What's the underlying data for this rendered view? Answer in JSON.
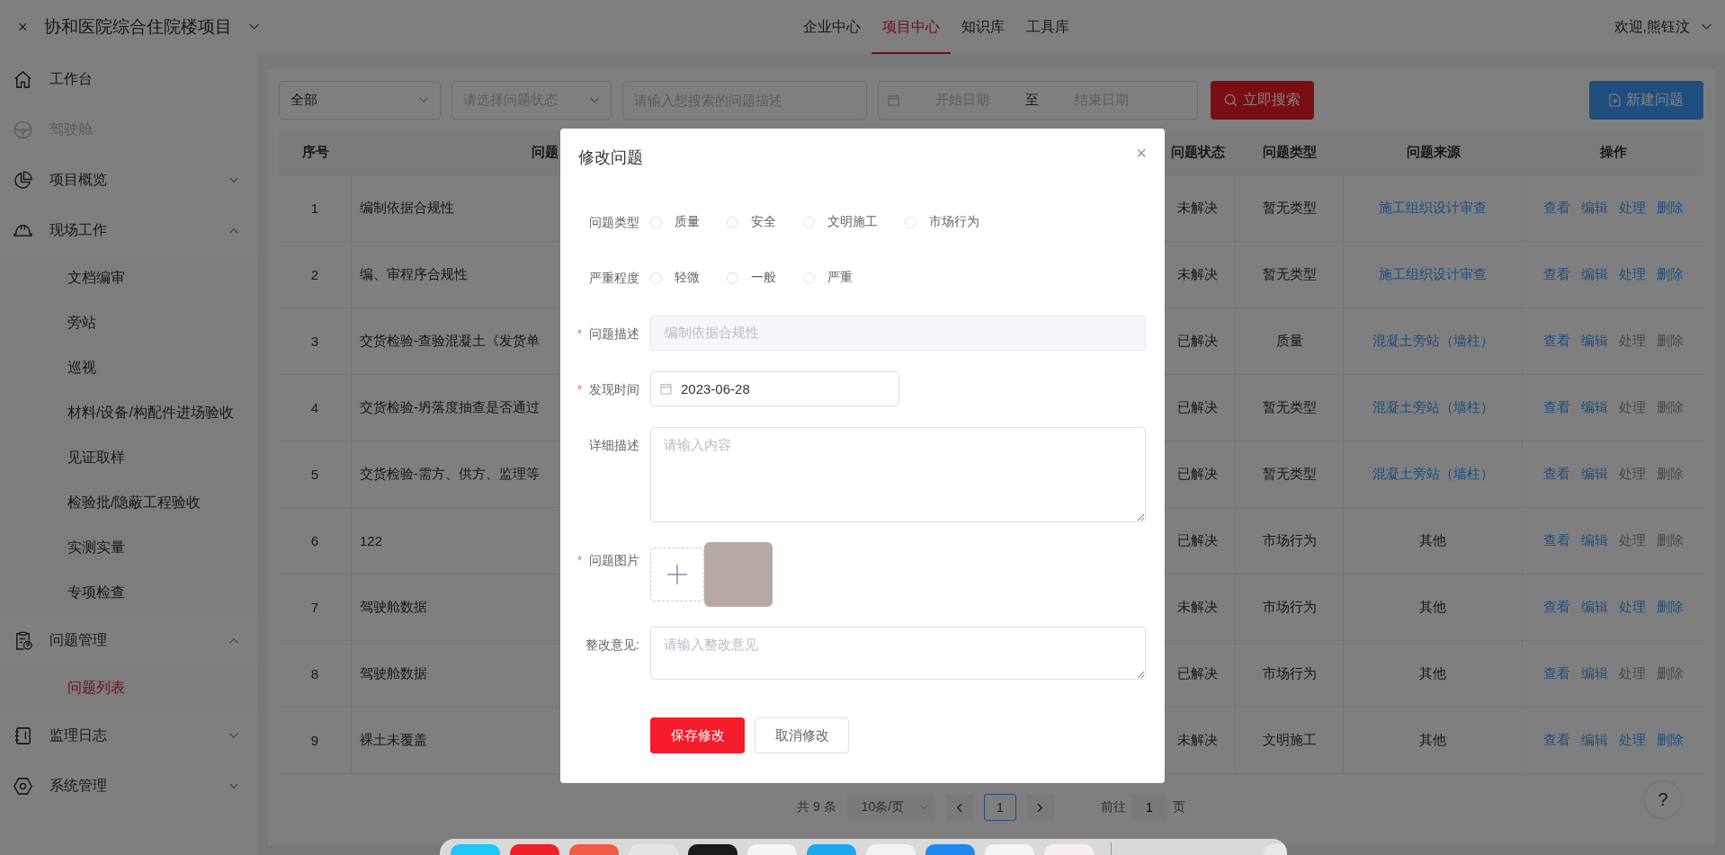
{
  "header": {
    "close": "×",
    "project": "协和医院综合住院楼项目",
    "nav": [
      {
        "label": "企业中心",
        "selected": false
      },
      {
        "label": "项目中心",
        "selected": true
      },
      {
        "label": "知识库",
        "selected": false
      },
      {
        "label": "工具库",
        "selected": false
      }
    ],
    "welcome": "欢迎,熊钰汶"
  },
  "sidebar": {
    "items": [
      {
        "label": "工作台",
        "disabled": false
      },
      {
        "label": "驾驶舱",
        "disabled": true
      },
      {
        "label": "项目概览",
        "disabled": false,
        "expanded": false
      },
      {
        "label": "现场工作",
        "disabled": false,
        "expanded": true,
        "children": [
          {
            "label": "文档编审",
            "selected": false
          },
          {
            "label": "旁站",
            "selected": false
          },
          {
            "label": "巡视",
            "selected": false
          },
          {
            "label": "材料/设备/构配件进场验收",
            "selected": false
          },
          {
            "label": "见证取样",
            "selected": false
          },
          {
            "label": "检验批/隐蔽工程验收",
            "selected": false
          },
          {
            "label": "实测实量",
            "selected": false
          },
          {
            "label": "专项检查",
            "selected": false
          }
        ]
      },
      {
        "label": "问题管理",
        "disabled": false,
        "expanded": true,
        "children": [
          {
            "label": "问题列表",
            "selected": true
          }
        ]
      },
      {
        "label": "监理日志",
        "disabled": false,
        "expanded": false
      },
      {
        "label": "系统管理",
        "disabled": false,
        "expanded": false
      }
    ]
  },
  "filters": {
    "scope": {
      "value": "全部"
    },
    "status": {
      "placeholder": "请选择问题状态"
    },
    "keyword": {
      "placeholder": "请输入想搜索的问题描述"
    },
    "date_range": {
      "start_placeholder": "开始日期",
      "separator": "至",
      "end_placeholder": "结束日期"
    },
    "search_button": "立即搜索",
    "new_button": "新建问题"
  },
  "table": {
    "columns": [
      "序号",
      "问题",
      "问题状态",
      "问题类型",
      "问题来源",
      "操作"
    ],
    "rows": [
      {
        "seq": "1",
        "description": "编制依据合规性",
        "status": "未解决",
        "type": "暂无类型",
        "source": {
          "text": "施工组织设计审查",
          "link": true
        },
        "actions": [
          {
            "label": "查看",
            "disabled": false
          },
          {
            "label": "编辑",
            "disabled": false
          },
          {
            "label": "处理",
            "disabled": false
          },
          {
            "label": "删除",
            "disabled": false
          }
        ]
      },
      {
        "seq": "2",
        "description": "编、审程序合规性",
        "status": "未解决",
        "type": "暂无类型",
        "source": {
          "text": "施工组织设计审查",
          "link": true
        },
        "actions": [
          {
            "label": "查看",
            "disabled": false
          },
          {
            "label": "编辑",
            "disabled": false
          },
          {
            "label": "处理",
            "disabled": false
          },
          {
            "label": "删除",
            "disabled": false
          }
        ]
      },
      {
        "seq": "3",
        "description": "交货检验-查验混凝土《发货单",
        "status": "已解决",
        "type": "质量",
        "source": {
          "text": "混凝土旁站（墙柱）",
          "link": true
        },
        "actions": [
          {
            "label": "查看",
            "disabled": false
          },
          {
            "label": "编辑",
            "disabled": false
          },
          {
            "label": "处理",
            "disabled": true
          },
          {
            "label": "删除",
            "disabled": true
          }
        ]
      },
      {
        "seq": "4",
        "description": "交货检验-坍落度抽查是否通过",
        "status": "已解决",
        "type": "暂无类型",
        "source": {
          "text": "混凝土旁站（墙柱）",
          "link": true
        },
        "actions": [
          {
            "label": "查看",
            "disabled": false
          },
          {
            "label": "编辑",
            "disabled": false
          },
          {
            "label": "处理",
            "disabled": true
          },
          {
            "label": "删除",
            "disabled": true
          }
        ]
      },
      {
        "seq": "5",
        "description": "交货检验-需方、供方、监理等",
        "status": "已解决",
        "type": "暂无类型",
        "source": {
          "text": "混凝土旁站（墙柱）",
          "link": true
        },
        "actions": [
          {
            "label": "查看",
            "disabled": false
          },
          {
            "label": "编辑",
            "disabled": false
          },
          {
            "label": "处理",
            "disabled": true
          },
          {
            "label": "删除",
            "disabled": true
          }
        ]
      },
      {
        "seq": "6",
        "description": "122",
        "status": "已解决",
        "type": "市场行为",
        "source": {
          "text": "其他",
          "link": false
        },
        "actions": [
          {
            "label": "查看",
            "disabled": false
          },
          {
            "label": "编辑",
            "disabled": false
          },
          {
            "label": "处理",
            "disabled": true
          },
          {
            "label": "删除",
            "disabled": true
          }
        ]
      },
      {
        "seq": "7",
        "description": "驾驶舱数据",
        "status": "未解决",
        "type": "市场行为",
        "source": {
          "text": "其他",
          "link": false
        },
        "actions": [
          {
            "label": "查看",
            "disabled": false
          },
          {
            "label": "编辑",
            "disabled": false
          },
          {
            "label": "处理",
            "disabled": false
          },
          {
            "label": "删除",
            "disabled": false
          }
        ]
      },
      {
        "seq": "8",
        "description": "驾驶舱数据",
        "status": "已解决",
        "type": "市场行为",
        "source": {
          "text": "其他",
          "link": false
        },
        "actions": [
          {
            "label": "查看",
            "disabled": false
          },
          {
            "label": "编辑",
            "disabled": false
          },
          {
            "label": "处理",
            "disabled": true
          },
          {
            "label": "删除",
            "disabled": true
          }
        ]
      },
      {
        "seq": "9",
        "description": "裸土未覆盖",
        "status": "未解决",
        "type": "文明施工",
        "source": {
          "text": "其他",
          "link": false
        },
        "actions": [
          {
            "label": "查看",
            "disabled": false
          },
          {
            "label": "编辑",
            "disabled": false
          },
          {
            "label": "处理",
            "disabled": false
          },
          {
            "label": "删除",
            "disabled": false
          }
        ]
      }
    ]
  },
  "pagination": {
    "total": "共 9 条",
    "page_size": "10条/页",
    "pages": [
      {
        "label": "1",
        "selected": true
      }
    ],
    "goto_label": "前往",
    "goto_value": "1",
    "goto_suffix": "页"
  },
  "help": "?",
  "modal": {
    "title": "修改问题",
    "close": "×",
    "fields": [
      {
        "kind": "radio",
        "label": "问题类型",
        "options": [
          {
            "label": "质量",
            "selected": false
          },
          {
            "label": "安全",
            "selected": false
          },
          {
            "label": "文明施工",
            "selected": false
          },
          {
            "label": "市场行为",
            "selected": false
          }
        ]
      },
      {
        "kind": "radio",
        "label": "严重程度",
        "options": [
          {
            "label": "轻微",
            "selected": false
          },
          {
            "label": "一般",
            "selected": false
          },
          {
            "label": "严重",
            "selected": false
          }
        ]
      },
      {
        "kind": "input",
        "label": "问题描述",
        "required_mark": "*",
        "value": "编制依据合规性",
        "disabled": true
      },
      {
        "kind": "date",
        "label": "发现时间",
        "required_mark": "*",
        "value": "2023-06-28"
      },
      {
        "kind": "textarea",
        "label": "详细描述",
        "placeholder": "请输入内容"
      },
      {
        "kind": "upload",
        "label": "问题图片",
        "required_mark": "*",
        "images": [
          {
            "kind": "photo"
          }
        ]
      },
      {
        "kind": "textarea",
        "label": "整改意见:",
        "placeholder": "请输入整改意见"
      }
    ],
    "save_button": "保存修改",
    "cancel_button": "取消修改"
  }
}
